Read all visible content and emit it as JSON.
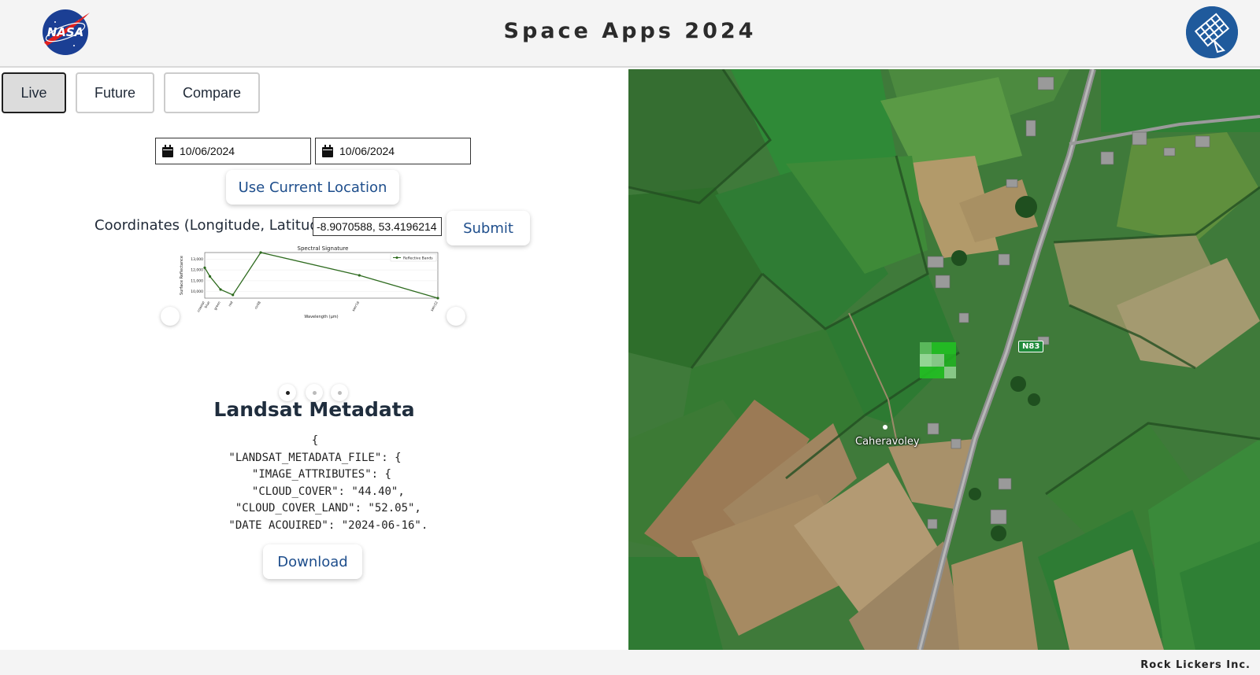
{
  "header": {
    "title": "Space Apps 2024",
    "nasa_logo_text": "NASA"
  },
  "tabs": [
    {
      "label": "Live",
      "active": true
    },
    {
      "label": "Future",
      "active": false
    },
    {
      "label": "Compare",
      "active": false
    }
  ],
  "dates": {
    "start": "10/06/2024",
    "end": "10/06/2024"
  },
  "location_button": "Use Current Location",
  "coordinates": {
    "label": "Coordinates (Longitude, Latitude):",
    "value": "-8.9070588, 53.4196214",
    "submit_label": "Submit"
  },
  "chart_data": {
    "type": "line",
    "title": "Spectral Signature",
    "xlabel": "Wavelength (μm)",
    "ylabel": "Surface Reflectance",
    "legend": "Reflective Bands",
    "legend_position": "top-right",
    "categories": [
      "coastal",
      "blue",
      "green",
      "red",
      "nir08",
      "swir16",
      "swir22"
    ],
    "x": [
      0.443,
      0.482,
      0.562,
      0.655,
      0.865,
      1.609,
      2.201
    ],
    "values": [
      12200,
      11400,
      10200,
      9700,
      13600,
      11500,
      9400
    ],
    "ylim": [
      9400,
      13600
    ],
    "yticks": [
      "10,000",
      "11,000",
      "12,000",
      "13,000"
    ],
    "line_color": "#2e6b1f",
    "grid": true
  },
  "carousel": {
    "page_count": 3,
    "active_index": 0
  },
  "metadata": {
    "title": "Landsat Metadata",
    "lines": [
      "{",
      "\"LANDSAT_METADATA_FILE\": {",
      "  \"IMAGE_ATTRIBUTES\": {",
      "    \"CLOUD_COVER\": \"44.40\",",
      "    \"CLOUD_COVER_LAND\": \"52.05\",",
      "    \"DATE_ACQUIRED\": \"2024-06-16\","
    ],
    "download_label": "Download"
  },
  "map": {
    "road_label": "N83",
    "place_label": "Caheravoley",
    "pixel_colors": [
      "#5fbf5f",
      "#22c022",
      "#22c022",
      "#9fdf9f",
      "#8fcf8f",
      "#22b022",
      "#22c022",
      "#22c022",
      "#8fcf8f"
    ]
  },
  "footer": {
    "text": "Rock Lickers Inc."
  },
  "colors": {
    "accent": "#1e4e8c",
    "header_bg": "#f4f4f4"
  }
}
